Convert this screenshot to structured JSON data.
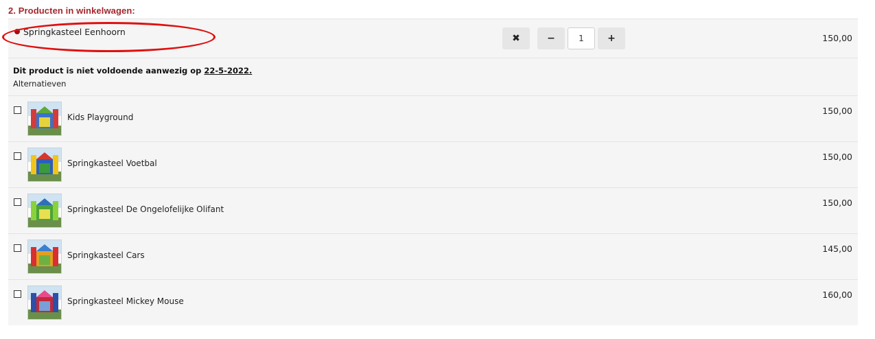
{
  "section": {
    "title": "2. Producten in winkelwagen:"
  },
  "cart_item": {
    "name": "Springkasteel Eenhoorn",
    "remove_icon": "✖",
    "minus_icon": "−",
    "plus_icon": "+",
    "quantity": "1",
    "price": "150,00"
  },
  "warning": {
    "text": "Dit product is niet voldoende aanwezig op ",
    "date": "22-5-2022.",
    "alternatives_label": "Alternatieven"
  },
  "alternatives": [
    {
      "name": "Kids Playground",
      "price": "150,00",
      "image_icon": "bouncy-castle-thumbnail"
    },
    {
      "name": "Springkasteel Voetbal",
      "price": "150,00",
      "image_icon": "bouncy-castle-thumbnail"
    },
    {
      "name": "Springkasteel De Ongelofelijke Olifant",
      "price": "150,00",
      "image_icon": "bouncy-castle-thumbnail"
    },
    {
      "name": "Springkasteel Cars",
      "price": "145,00",
      "image_icon": "bouncy-castle-thumbnail"
    },
    {
      "name": "Springkasteel Mickey Mouse",
      "price": "160,00",
      "image_icon": "bouncy-castle-thumbnail"
    }
  ],
  "colors": {
    "title_red": "#a4262c",
    "bullet_red": "#a01010",
    "highlight_red": "#e01010",
    "row_bg": "#f5f5f5"
  }
}
